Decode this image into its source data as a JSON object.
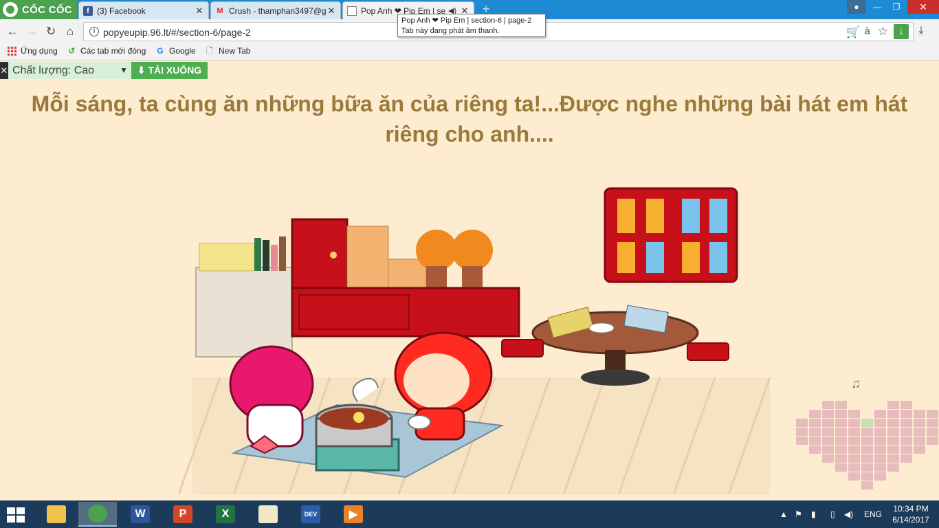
{
  "browser": {
    "brand": "CỐC CỐC",
    "tabs": [
      {
        "title": "(3) Facebook",
        "icon": "facebook-icon"
      },
      {
        "title": "Crush - thamphan3497@g",
        "icon": "gmail-icon"
      },
      {
        "title": "Pop Anh ❤ Pip Em | se",
        "icon": "page-icon",
        "active": true
      }
    ],
    "tooltip": {
      "line1": "Pop Anh ❤ Pip Em | section-6 | page-2",
      "line2": "Tab này đang phát âm thanh."
    },
    "url": "popyeupip.96.lt/#/section-6/page-2",
    "bookmarks": [
      "Ứng dụng",
      "Các tab mới đóng",
      "Google",
      "New Tab"
    ]
  },
  "page": {
    "quality_select": "Chất lượng: Cao",
    "download_label": "TẢI XUỐNG",
    "heading": "Mỗi sáng, ta cùng ăn những bữa ăn của riêng ta!...Được nghe những bài hát em hát riêng cho anh....",
    "heart_lit_cell": "row 2, column 6"
  },
  "taskbar": {
    "apps": [
      "file-explorer",
      "coccoc-browser",
      "word",
      "powerpoint",
      "excel",
      "paint",
      "dev-cpp",
      "media-player"
    ],
    "language": "ENG",
    "time": "10:34 PM",
    "date": "6/14/2017"
  },
  "colors": {
    "titlebar": "#1f8ad4",
    "brand_green": "#4aa14f",
    "page_background": "#fdecd0",
    "heading": "#9a7a3c",
    "taskbar": "#1c3b5a"
  }
}
